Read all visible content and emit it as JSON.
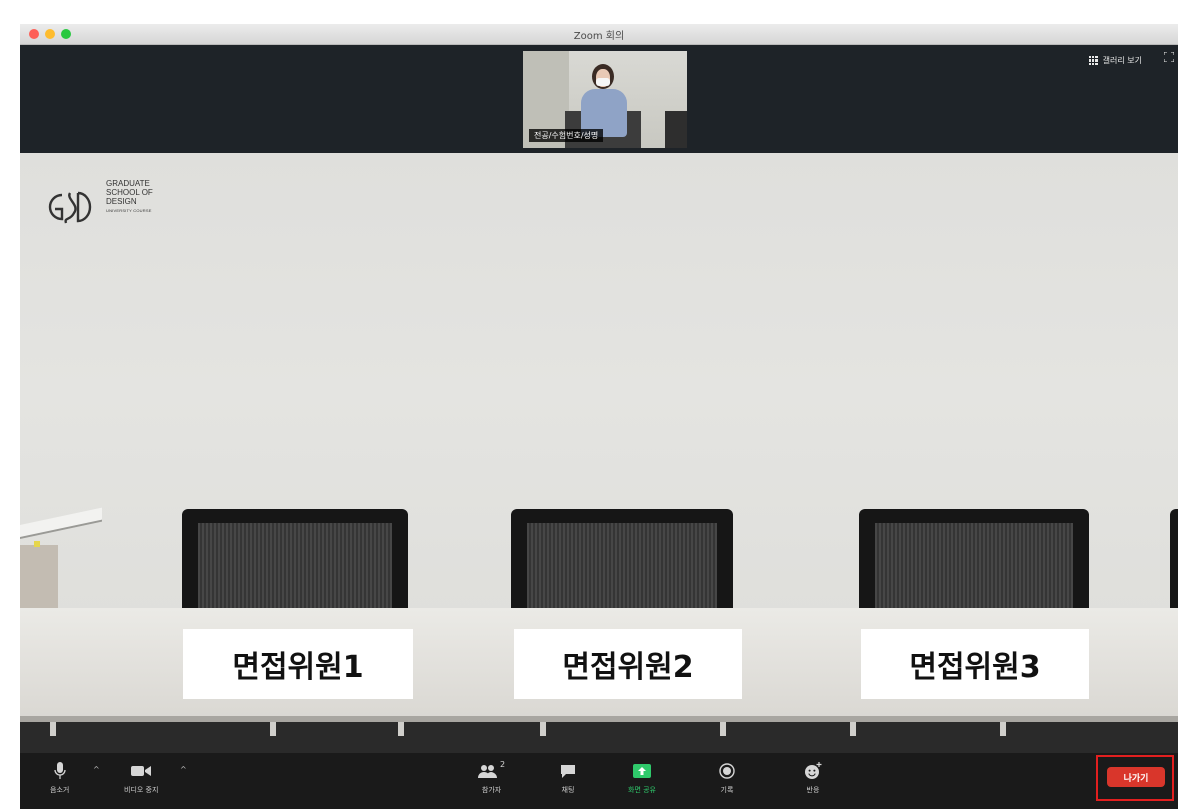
{
  "window": {
    "title": "Zoom 회의"
  },
  "self_view": {
    "name": "전공/수험번호/성명"
  },
  "header": {
    "gallery_view_label": "갤러리 보기"
  },
  "main": {
    "logo": {
      "line1": "GRADUATE",
      "line2": "SCHOOL OF",
      "line3": "DESIGN",
      "line4": "UNIVERSITY COURSE"
    },
    "labels": [
      "면접위원1",
      "면접위원2",
      "면접위원3"
    ]
  },
  "toolbar": {
    "mute_label": "음소거",
    "video_label": "비디오 중지",
    "participants_label": "참가자",
    "participants_count": "2",
    "chat_label": "채팅",
    "share_label": "화면 공유",
    "record_label": "기록",
    "reactions_label": "반응",
    "leave_label": "나가기"
  },
  "colors": {
    "share_accent": "#2fc96b",
    "leave": "#d9362b",
    "highlight_border": "#e21f1f"
  }
}
